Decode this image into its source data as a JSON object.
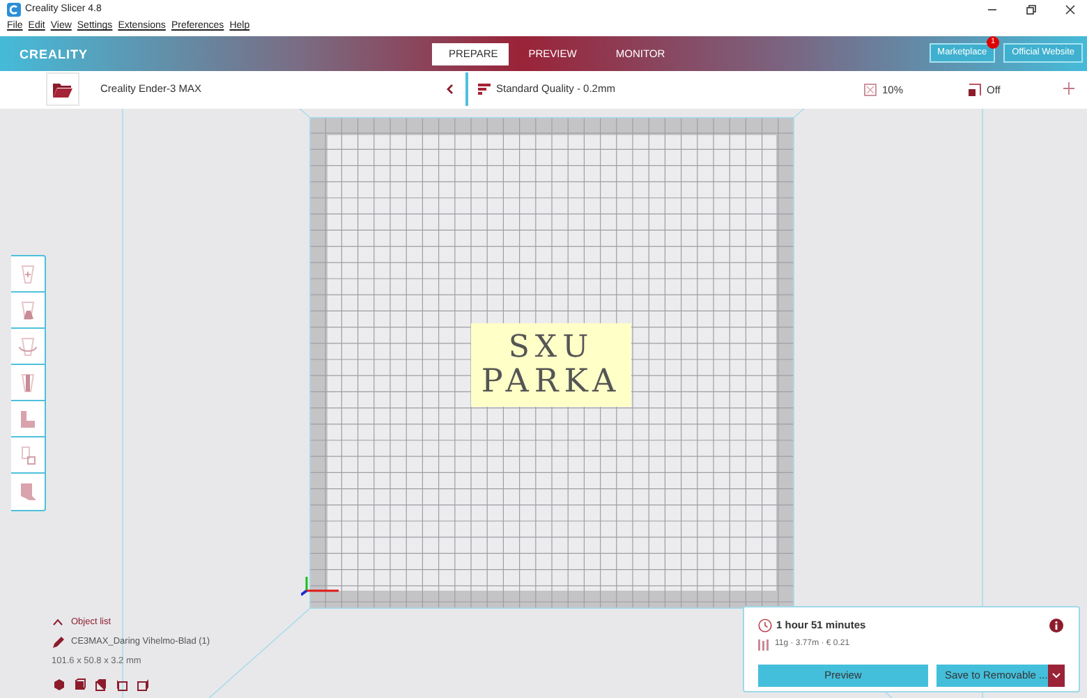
{
  "window": {
    "title": "Creality Slicer 4.8"
  },
  "menu": [
    "File",
    "Edit",
    "View",
    "Settings",
    "Extensions",
    "Preferences",
    "Help"
  ],
  "header": {
    "logo": "CREALITY",
    "tabs": [
      {
        "label": "PREPARE",
        "selected": true
      },
      {
        "label": "PREVIEW",
        "selected": false
      },
      {
        "label": "MONITOR",
        "selected": false
      }
    ],
    "buttons": [
      {
        "label": "Marketplace",
        "badge": "1"
      },
      {
        "label": "Official Website"
      }
    ]
  },
  "settings_bar": {
    "printer": "Creality Ender-3 MAX",
    "quality": "Standard Quality - 0.2mm",
    "infill": "10%",
    "support": "Off"
  },
  "model": {
    "lines": [
      "SXU",
      "PARKA"
    ]
  },
  "object_list": {
    "toggle": "Object list",
    "expanded": true,
    "object": "CE3MAX_Daring Vihelmo-Blad (1)",
    "dimensions": "101.6 x 50.8 x 3.2 mm"
  },
  "print_panel": {
    "time": "1 hour 51 minutes",
    "material": "11g · 3.77m · € 0.21",
    "preview_button": "Preview",
    "save_button": "Save to Removable ..."
  }
}
